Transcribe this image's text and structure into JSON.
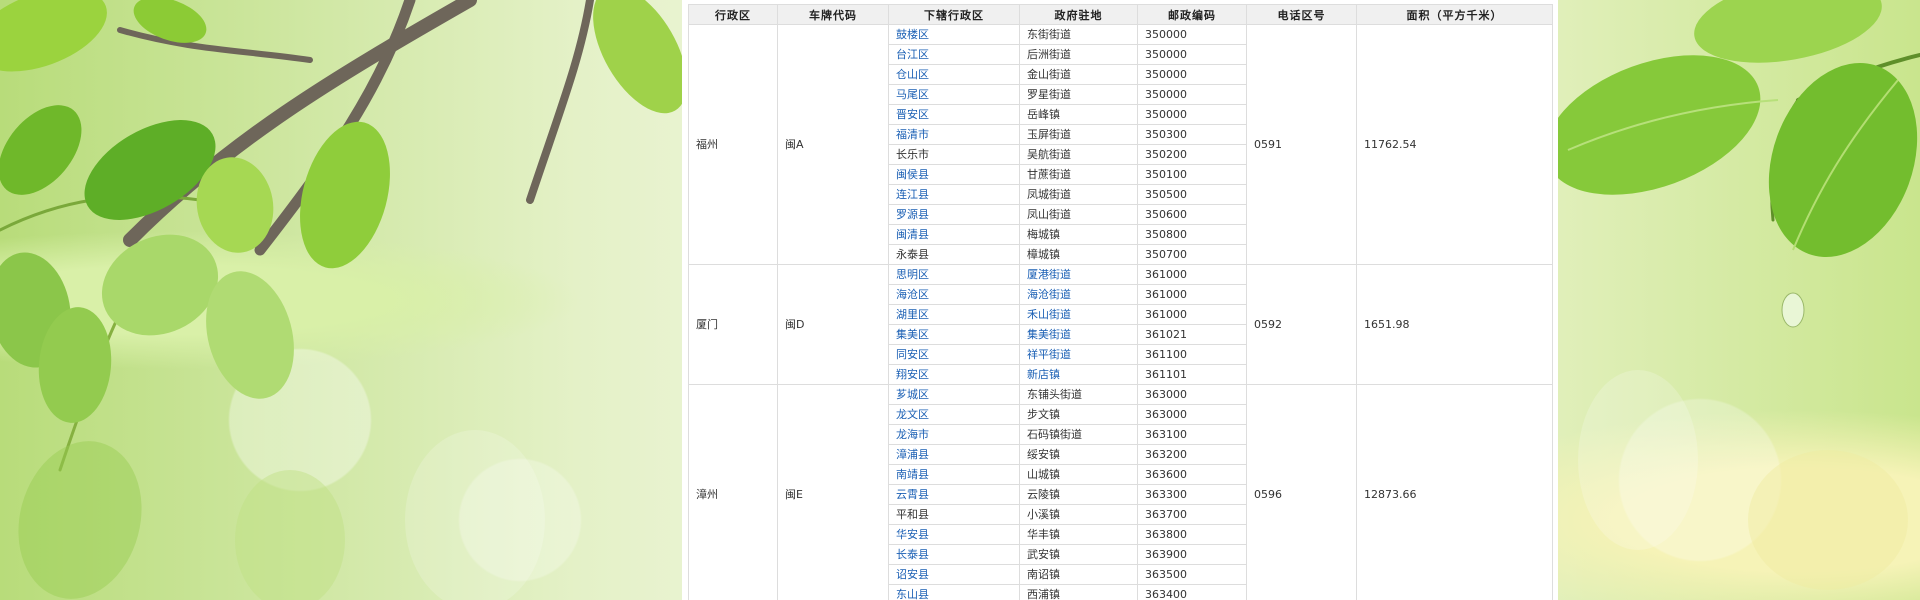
{
  "table": {
    "headers": [
      "行政区",
      "车牌代码",
      "下辖行政区",
      "政府驻地",
      "邮政编码",
      "电话区号",
      "面积（平方千米）"
    ],
    "groups": [
      {
        "city": "福州",
        "plate": "闽A",
        "area_code": "0591",
        "area": "11762.54",
        "rows": [
          {
            "district": "鼓楼区",
            "district_link": true,
            "seat": "东街街道",
            "seat_link": false,
            "postcode": "350000"
          },
          {
            "district": "台江区",
            "district_link": true,
            "seat": "后洲街道",
            "seat_link": false,
            "postcode": "350000"
          },
          {
            "district": "仓山区",
            "district_link": true,
            "seat": "金山街道",
            "seat_link": false,
            "postcode": "350000"
          },
          {
            "district": "马尾区",
            "district_link": true,
            "seat": "罗星街道",
            "seat_link": false,
            "postcode": "350000"
          },
          {
            "district": "晋安区",
            "district_link": true,
            "seat": "岳峰镇",
            "seat_link": false,
            "postcode": "350000"
          },
          {
            "district": "福清市",
            "district_link": true,
            "seat": "玉屏街道",
            "seat_link": false,
            "postcode": "350300"
          },
          {
            "district": "长乐市",
            "district_link": false,
            "seat": "吴航街道",
            "seat_link": false,
            "postcode": "350200"
          },
          {
            "district": "闽侯县",
            "district_link": true,
            "seat": "甘蔗街道",
            "seat_link": false,
            "postcode": "350100"
          },
          {
            "district": "连江县",
            "district_link": true,
            "seat": "凤城街道",
            "seat_link": false,
            "postcode": "350500"
          },
          {
            "district": "罗源县",
            "district_link": true,
            "seat": "凤山街道",
            "seat_link": false,
            "postcode": "350600"
          },
          {
            "district": "闽清县",
            "district_link": true,
            "seat": "梅城镇",
            "seat_link": false,
            "postcode": "350800"
          },
          {
            "district": "永泰县",
            "district_link": false,
            "seat": "樟城镇",
            "seat_link": false,
            "postcode": "350700"
          }
        ]
      },
      {
        "city": "厦门",
        "plate": "闽D",
        "area_code": "0592",
        "area": "1651.98",
        "rows": [
          {
            "district": "思明区",
            "district_link": true,
            "seat": "厦港街道",
            "seat_link": true,
            "postcode": "361000"
          },
          {
            "district": "海沧区",
            "district_link": true,
            "seat": "海沧街道",
            "seat_link": true,
            "postcode": "361000"
          },
          {
            "district": "湖里区",
            "district_link": true,
            "seat": "禾山街道",
            "seat_link": true,
            "postcode": "361000"
          },
          {
            "district": "集美区",
            "district_link": true,
            "seat": "集美街道",
            "seat_link": true,
            "postcode": "361021"
          },
          {
            "district": "同安区",
            "district_link": true,
            "seat": "祥平街道",
            "seat_link": true,
            "postcode": "361100"
          },
          {
            "district": "翔安区",
            "district_link": true,
            "seat": "新店镇",
            "seat_link": true,
            "postcode": "361101"
          }
        ]
      },
      {
        "city": "漳州",
        "plate": "闽E",
        "area_code": "0596",
        "area": "12873.66",
        "rows": [
          {
            "district": "芗城区",
            "district_link": true,
            "seat": "东铺头街道",
            "seat_link": false,
            "postcode": "363000"
          },
          {
            "district": "龙文区",
            "district_link": true,
            "seat": "步文镇",
            "seat_link": false,
            "postcode": "363000"
          },
          {
            "district": "龙海市",
            "district_link": true,
            "seat": "石码镇街道",
            "seat_link": false,
            "postcode": "363100"
          },
          {
            "district": "漳浦县",
            "district_link": true,
            "seat": "绥安镇",
            "seat_link": false,
            "postcode": "363200"
          },
          {
            "district": "南靖县",
            "district_link": true,
            "seat": "山城镇",
            "seat_link": false,
            "postcode": "363600"
          },
          {
            "district": "云霄县",
            "district_link": true,
            "seat": "云陵镇",
            "seat_link": false,
            "postcode": "363300"
          },
          {
            "district": "平和县",
            "district_link": false,
            "seat": "小溪镇",
            "seat_link": false,
            "postcode": "363700"
          },
          {
            "district": "华安县",
            "district_link": true,
            "seat": "华丰镇",
            "seat_link": false,
            "postcode": "363800"
          },
          {
            "district": "长泰县",
            "district_link": true,
            "seat": "武安镇",
            "seat_link": false,
            "postcode": "363900"
          },
          {
            "district": "诏安县",
            "district_link": true,
            "seat": "南诏镇",
            "seat_link": false,
            "postcode": "363500"
          },
          {
            "district": "东山县",
            "district_link": true,
            "seat": "西浦镇",
            "seat_link": false,
            "postcode": "363400"
          }
        ]
      }
    ]
  },
  "colors": {
    "link": "#1a5fb4",
    "header_bg": "#f0f0f0",
    "border": "#dddddd",
    "leaf": "#7cc23a",
    "leaf_dark": "#4f9a1f",
    "branch": "#6b6358"
  }
}
